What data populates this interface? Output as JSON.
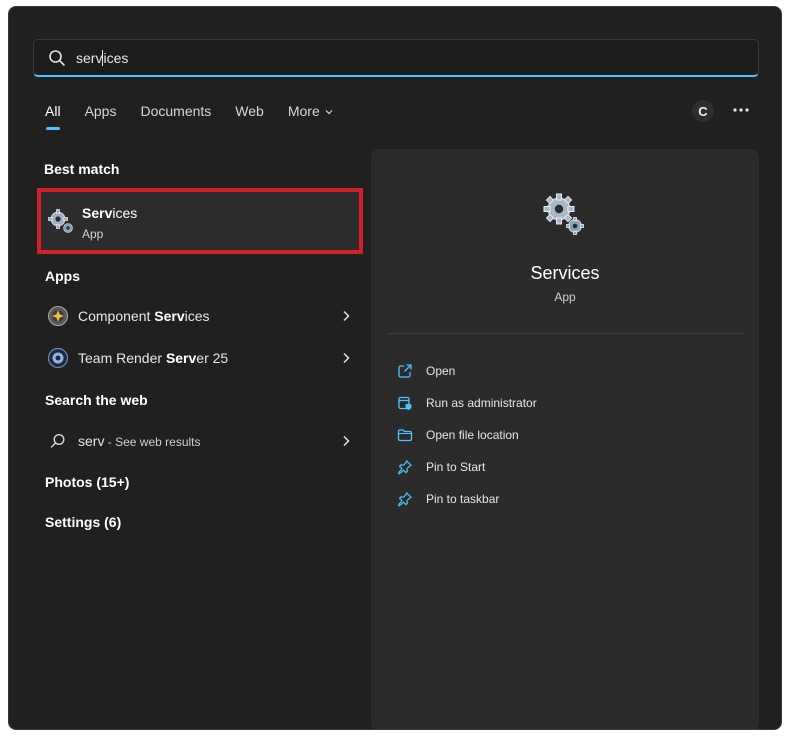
{
  "search": {
    "value_pre": "serv",
    "value_post": "ices"
  },
  "tabs": [
    {
      "label": "All"
    },
    {
      "label": "Apps"
    },
    {
      "label": "Documents"
    },
    {
      "label": "Web"
    },
    {
      "label": "More"
    }
  ],
  "profile": {
    "initial": "C"
  },
  "sections": {
    "best_match": "Best match",
    "apps": "Apps",
    "search_web": "Search the web",
    "photos": "Photos (15+)",
    "settings": "Settings (6)"
  },
  "best_match": {
    "name_bold": "Serv",
    "name_rest": "ices",
    "type": "App"
  },
  "apps": [
    {
      "pre": "Component ",
      "bold": "Serv",
      "post": "ices"
    },
    {
      "pre": "Team Render ",
      "bold": "Serv",
      "post": "er 25"
    }
  ],
  "web": {
    "query": "serv",
    "suffix": " - See web results"
  },
  "panel": {
    "title": "Services",
    "subtitle": "App",
    "actions": [
      {
        "label": "Open",
        "icon": "open-external-icon"
      },
      {
        "label": "Run as administrator",
        "icon": "shield-icon"
      },
      {
        "label": "Open file location",
        "icon": "folder-icon"
      },
      {
        "label": "Pin to Start",
        "icon": "pin-icon"
      },
      {
        "label": "Pin to taskbar",
        "icon": "pin-icon"
      }
    ]
  },
  "colors": {
    "accent": "#4cc2ff",
    "highlight_border": "#d0202a",
    "background": "#202020",
    "panel": "#2b2b2b"
  }
}
